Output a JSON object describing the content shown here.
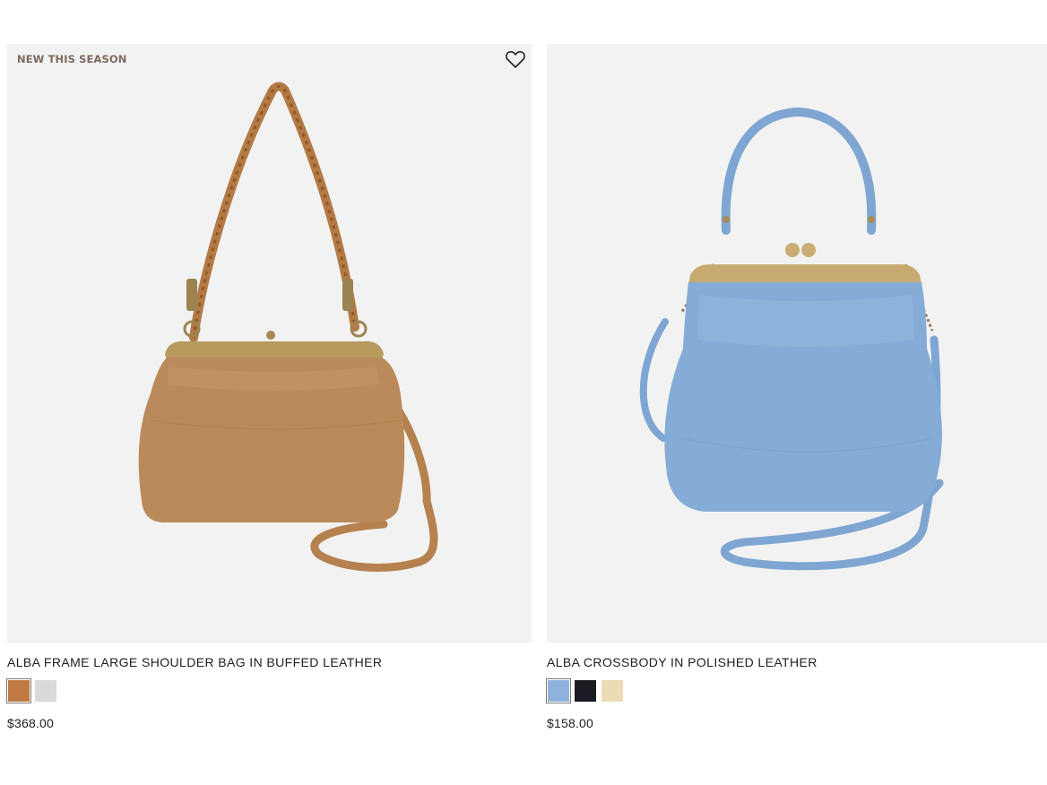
{
  "products": [
    {
      "badge": "NEW THIS SEASON",
      "title": "ALBA FRAME LARGE SHOULDER BAG IN BUFFED LEATHER",
      "price": "$368.00",
      "swatches": [
        {
          "color": "#c27a43",
          "selected": true
        },
        {
          "color": "#dcdad8",
          "selected": false
        }
      ],
      "image_alt": "Tan leather frame shoulder bag with braided strap"
    },
    {
      "badge": "",
      "title": "ALBA CROSSBODY IN POLISHED LEATHER",
      "price": "$158.00",
      "swatches": [
        {
          "color": "#8fb2dc",
          "selected": true
        },
        {
          "color": "#1c1c24",
          "selected": false
        },
        {
          "color": "#ecdcb6",
          "selected": false
        }
      ],
      "image_alt": "Light blue leather frame crossbody bag"
    }
  ],
  "icons": {
    "wishlist": "heart-outline-icon"
  },
  "colors": {
    "image_bg": "#f2f2f2",
    "badge_text": "#7d6a5f",
    "tan_leather": "#b98758",
    "blue_leather": "#84acd6",
    "brass": "#b89a5e"
  }
}
